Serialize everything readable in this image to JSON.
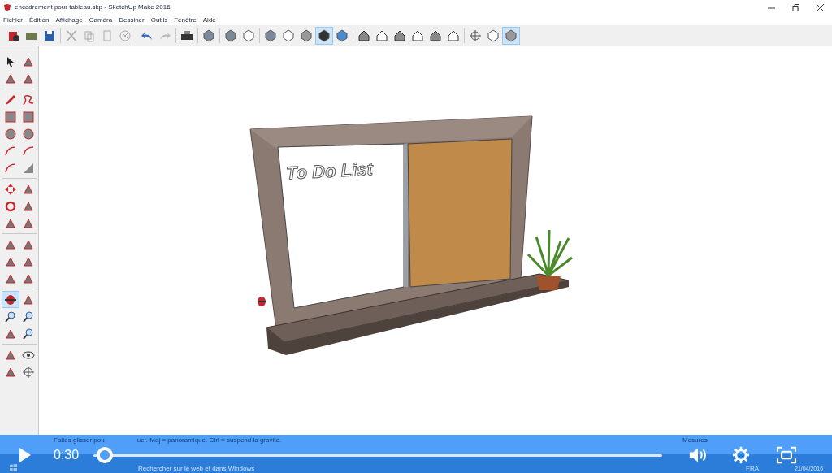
{
  "window": {
    "title": "encadrement pour tableau.skp - SketchUp Make 2016"
  },
  "menu": [
    "Fichier",
    "Édition",
    "Affichage",
    "Caméra",
    "Dessiner",
    "Outils",
    "Fenêtre",
    "Aide"
  ],
  "toolbar": {
    "groups": [
      [
        {
          "selected": false
        },
        {
          "selected": false
        },
        {
          "selected": false
        }
      ],
      [
        {
          "selected": false
        },
        {
          "selected": false
        },
        {
          "selected": false
        },
        {
          "selected": false
        }
      ],
      [
        {
          "selected": false
        },
        {
          "selected": false
        }
      ],
      [
        {
          "selected": false
        }
      ],
      [
        {
          "selected": false
        }
      ],
      [
        {
          "selected": false
        },
        {
          "selected": false
        }
      ],
      [
        {
          "selected": false
        },
        {
          "selected": false
        },
        {
          "selected": false
        },
        {
          "selected": true
        },
        {
          "selected": false
        }
      ],
      [
        {
          "selected": false
        },
        {
          "selected": false
        },
        {
          "selected": false
        },
        {
          "selected": false
        },
        {
          "selected": false
        },
        {
          "selected": false
        }
      ],
      [
        {
          "selected": false
        },
        {
          "selected": false
        },
        {
          "selected": true
        }
      ]
    ]
  },
  "tools": {
    "groups": [
      [
        {
          "selected": false
        },
        {
          "selected": false
        },
        {
          "selected": false
        },
        {
          "selected": false
        }
      ],
      [
        {
          "selected": false
        },
        {
          "selected": false
        },
        {
          "selected": false
        },
        {
          "selected": false
        },
        {
          "selected": false
        },
        {
          "selected": false
        },
        {
          "selected": false
        },
        {
          "selected": false
        },
        {
          "selected": false
        },
        {
          "selected": false
        }
      ],
      [
        {
          "selected": false
        },
        {
          "selected": false
        },
        {
          "selected": false
        },
        {
          "selected": false
        },
        {
          "selected": false
        },
        {
          "selected": false
        }
      ],
      [
        {
          "selected": false
        },
        {
          "selected": false
        },
        {
          "selected": false
        },
        {
          "selected": false
        },
        {
          "selected": false
        },
        {
          "selected": false
        }
      ],
      [
        {
          "selected": true
        },
        {
          "selected": false
        },
        {
          "selected": false
        },
        {
          "selected": false
        },
        {
          "selected": false
        },
        {
          "selected": false
        }
      ],
      [
        {
          "selected": false
        },
        {
          "selected": false
        },
        {
          "selected": false
        },
        {
          "selected": false
        }
      ]
    ]
  },
  "model": {
    "board_text": "To Do List"
  },
  "status_bar": {
    "hint_start": "Faites glisser pou",
    "hint_end": "uer. Maj = panoramique. Ctrl =  suspend la gravité.",
    "measure_label": "Mesures"
  },
  "taskbar": {
    "search": "Rechercher sur le web et dans Windows",
    "language": "FRA",
    "date": "21/04/2016"
  },
  "player": {
    "time": "0:30",
    "level": 0.02
  }
}
